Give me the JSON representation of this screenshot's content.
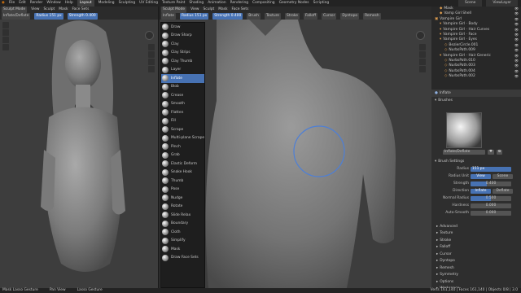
{
  "topbar": {
    "menu": [
      "File",
      "Edit",
      "Render",
      "Window",
      "Help"
    ],
    "tabs": [
      "Layout",
      "Modeling",
      "Sculpting",
      "UV Editing",
      "Texture Paint",
      "Shading",
      "Animation",
      "Rendering",
      "Compositing",
      "Geometry Nodes",
      "Scripting"
    ],
    "active_tab": "Layout",
    "scene": "Scene",
    "view_layer": "ViewLayer"
  },
  "left_header": {
    "mode": "Sculpt Mode",
    "menus": [
      "View",
      "Sculpt",
      "Mask",
      "Face Sets"
    ],
    "brush_name": "Inflate/Deflate",
    "radius_label": "Radius",
    "radius_value": "151 px",
    "strength_label": "Strength",
    "strength_value": "0.400"
  },
  "right_header": {
    "mode": "Sculpt Mode",
    "menus": [
      "View",
      "Sculpt",
      "Mask",
      "Face Sets"
    ],
    "brush_name": "Inflate",
    "radius_label": "Radius",
    "radius_value": "151 px",
    "strength_label": "Strength",
    "strength_value": "0.400",
    "tabs": [
      "Brush",
      "Texture",
      "Stroke",
      "Falloff",
      "Cursor"
    ],
    "dyntopo": "Dyntopo",
    "remesh": "Remesh"
  },
  "brushes": [
    "Draw",
    "Draw Sharp",
    "Clay",
    "Clay Strips",
    "Clay Thumb",
    "Layer",
    "Inflate",
    "Blob",
    "Crease",
    "Smooth",
    "Flatten",
    "Fill",
    "Scrape",
    "Multi-plane Scrape",
    "Pinch",
    "Grab",
    "Elastic Deform",
    "Snake Hook",
    "Thumb",
    "Pose",
    "Nudge",
    "Rotate",
    "Slide Relax",
    "Boundary",
    "Cloth",
    "Simplify",
    "Mask",
    "Draw Face Sets"
  ],
  "selected_brush": "Inflate",
  "outliner": {
    "rows": [
      {
        "icon": "◆",
        "name": "Mask",
        "indent": 1
      },
      {
        "icon": "◆",
        "name": "Vamp Girl Shell",
        "indent": 1
      },
      {
        "icon": "▣",
        "name": "Vampire Girl",
        "indent": 0
      },
      {
        "icon": "▾",
        "name": "Vampire Girl · Body",
        "indent": 1
      },
      {
        "icon": "▾",
        "name": "Vampire Girl · Hair Curves",
        "indent": 1
      },
      {
        "icon": "▾",
        "name": "Vampire Girl · Face",
        "indent": 1
      },
      {
        "icon": "▾",
        "name": "Vampire Girl · Eyes",
        "indent": 1
      },
      {
        "icon": "◇",
        "name": "BezierCircle.001",
        "indent": 2
      },
      {
        "icon": "◇",
        "name": "NurbsPath.009",
        "indent": 2
      },
      {
        "icon": "▾",
        "name": "Vampire Girl · Hair Generic",
        "indent": 1
      },
      {
        "icon": "◇",
        "name": "NurbsPath.010",
        "indent": 2
      },
      {
        "icon": "◇",
        "name": "NurbsPath.003",
        "indent": 2
      },
      {
        "icon": "◇",
        "name": "NurbsPath.004",
        "indent": 2
      },
      {
        "icon": "◇",
        "name": "NurbsPath.002",
        "indent": 2
      }
    ]
  },
  "properties": {
    "tool_title": "Inflate",
    "brushes_panel": "Brushes",
    "brush_name": "Inflate/Deflate",
    "brush_settings_panel": "Brush Settings",
    "radius_label": "Radius",
    "radius_value": "151 px",
    "radius_unit_label": "Radius Unit",
    "radius_unit_view": "View",
    "radius_unit_scene": "Scene",
    "strength_label": "Strength",
    "strength_value": "0.400",
    "direction_label": "Direction",
    "direction_inflate": "Inflate",
    "direction_deflate": "Deflate",
    "normal_radius_label": "Normal Radius",
    "normal_radius_value": "0.500",
    "hardness_label": "Hardness",
    "hardness_value": "0.000",
    "auto_smooth_label": "Auto-Smooth",
    "auto_smooth_value": "0.000",
    "subpanels": [
      "Advanced",
      "Texture",
      "Stroke",
      "Falloff",
      "Cursor",
      "Dyntopo",
      "Remesh",
      "Symmetry",
      "Options",
      "Workspace"
    ]
  },
  "statusbar": {
    "items": [
      "Mask Lasso Gesture",
      "Pan View",
      "Lasso Gesture"
    ],
    "stats": "Verts 161,140 | Faces 161,140 | Objects 0/8 | 3.0"
  },
  "colors": {
    "accent": "#4772b3",
    "viewport_bg": "#3d3d3d",
    "cursor": "#4d7fd6"
  }
}
